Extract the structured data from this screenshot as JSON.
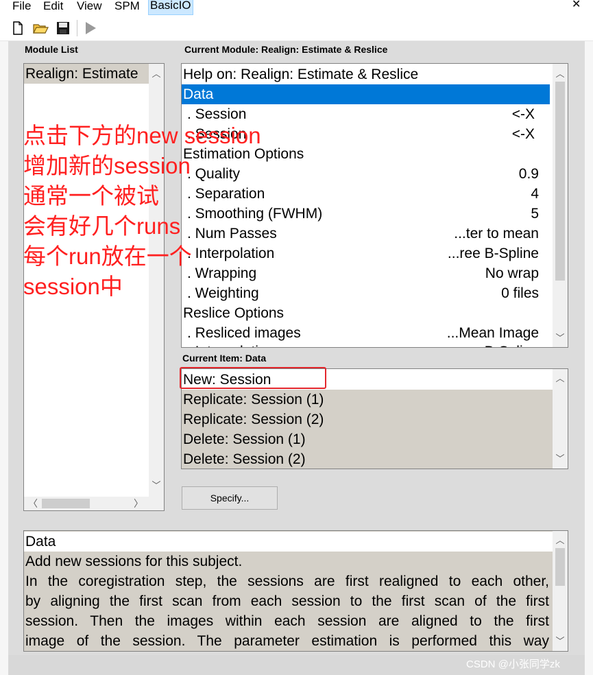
{
  "menu": {
    "items": [
      {
        "label": "File"
      },
      {
        "label": "Edit"
      },
      {
        "label": "View"
      },
      {
        "label": "SPM"
      },
      {
        "label": "BasicIO"
      }
    ]
  },
  "toolbar": {
    "icons": [
      "new-file-icon",
      "open-folder-icon",
      "save-icon",
      "run-icon"
    ]
  },
  "module_list": {
    "label": "Module List",
    "items": [
      "Realign: Estimate"
    ]
  },
  "current_module": {
    "label": "Current Module: Realign: Estimate & Reslice",
    "rows": [
      {
        "label": "Help on: Realign: Estimate & Reslice",
        "value": ""
      },
      {
        "label": "Data",
        "value": ""
      },
      {
        "label": ". Session",
        "value": "<-X"
      },
      {
        "label": ". Session",
        "value": "<-X"
      },
      {
        "label": "Estimation Options",
        "value": ""
      },
      {
        "label": ". Quality",
        "value": "0.9"
      },
      {
        "label": ". Separation",
        "value": "4"
      },
      {
        "label": ". Smoothing (FWHM)",
        "value": "5"
      },
      {
        "label": ". Num Passes",
        "value": "...ter to mean"
      },
      {
        "label": ". Interpolation",
        "value": "...ree B-Spline"
      },
      {
        "label": ". Wrapping",
        "value": "No wrap"
      },
      {
        "label": ". Weighting",
        "value": "0 files"
      },
      {
        "label": "Reslice Options",
        "value": ""
      },
      {
        "label": ". Resliced images",
        "value": "...Mean Image"
      },
      {
        "label": ". Interpolation",
        "value": "...ree B-Spline"
      }
    ]
  },
  "current_item": {
    "label": "Current Item: Data",
    "options": [
      "New: Session",
      "Replicate: Session (1)",
      "Replicate: Session (2)",
      "Delete: Session (1)",
      "Delete: Session (2)"
    ]
  },
  "specify_button": "Specify...",
  "help_text": {
    "lines": [
      "Data",
      "Add new sessions for this subject.",
      "In  the  coregistration  step, the sessions are first realigned to each other,",
      "by  aligning  the  first  scan  from each session to the first scan of the first",
      "session.   Then  the  images  within  each session are aligned to the first",
      "image  of  the  session.  The  parameter  estimation is performed this way"
    ]
  },
  "annotation": {
    "lines": [
      "点击下方的new session",
      "增加新的session",
      "通常一个被试",
      "会有好几个runs",
      "每个run放在一个",
      "session中"
    ]
  },
  "watermark": "CSDN @小张同学zk",
  "colors": {
    "selection": "#0078d7",
    "annotation_red": "#ff2020",
    "list_gray": "#d4d0c8"
  }
}
